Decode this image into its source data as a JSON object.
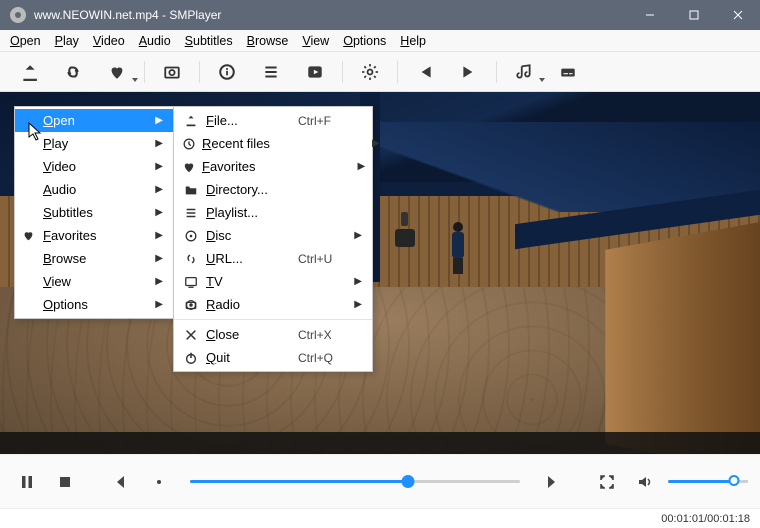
{
  "titlebar": {
    "title": "www.NEOWIN.net.mp4 - SMPlayer"
  },
  "menubar": [
    "Open",
    "Play",
    "Video",
    "Audio",
    "Subtitles",
    "Browse",
    "View",
    "Options",
    "Help"
  ],
  "toolbar": [
    {
      "name": "open-file-icon"
    },
    {
      "name": "open-url-icon"
    },
    {
      "name": "favorite-icon",
      "drop": true
    },
    {
      "sep": true
    },
    {
      "name": "screenshot-icon"
    },
    {
      "sep": true
    },
    {
      "name": "info-icon"
    },
    {
      "name": "playlist-icon"
    },
    {
      "name": "play-icon"
    },
    {
      "sep": true
    },
    {
      "name": "settings-icon"
    },
    {
      "sep": true
    },
    {
      "name": "prev-icon"
    },
    {
      "name": "next-icon"
    },
    {
      "sep": true
    },
    {
      "name": "audio-icon",
      "drop": true
    },
    {
      "name": "subtitles-icon"
    }
  ],
  "context_menu_1": [
    {
      "label": "Open",
      "selected": true,
      "submenu": true
    },
    {
      "label": "Play",
      "submenu": true
    },
    {
      "label": "Video",
      "submenu": true
    },
    {
      "label": "Audio",
      "submenu": true
    },
    {
      "label": "Subtitles",
      "submenu": true
    },
    {
      "label": "Favorites",
      "icon": "heart",
      "submenu": true
    },
    {
      "label": "Browse",
      "submenu": true
    },
    {
      "label": "View",
      "submenu": true
    },
    {
      "label": "Options",
      "submenu": true
    }
  ],
  "context_menu_2": [
    {
      "icon": "file",
      "label": "File...",
      "shortcut": "Ctrl+F"
    },
    {
      "icon": "recent",
      "label": "Recent files",
      "submenu": true
    },
    {
      "icon": "heart",
      "label": "Favorites",
      "submenu": true
    },
    {
      "icon": "folder",
      "label": "Directory..."
    },
    {
      "icon": "list",
      "label": "Playlist..."
    },
    {
      "icon": "disc",
      "label": "Disc",
      "submenu": true
    },
    {
      "icon": "link",
      "label": "URL...",
      "shortcut": "Ctrl+U"
    },
    {
      "icon": "tv",
      "label": "TV",
      "submenu": true
    },
    {
      "icon": "radio",
      "label": "Radio",
      "submenu": true
    },
    {
      "hr": true
    },
    {
      "icon": "close",
      "label": "Close",
      "shortcut": "Ctrl+X"
    },
    {
      "icon": "power",
      "label": "Quit",
      "shortcut": "Ctrl+Q"
    }
  ],
  "playback": {
    "seek_percent": 66,
    "volume_percent": 82
  },
  "status": {
    "current": "00:01:01",
    "total": "00:01:18",
    "sep": " / "
  }
}
